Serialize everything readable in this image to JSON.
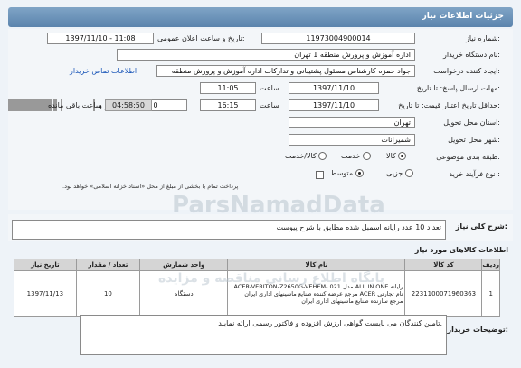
{
  "header": {
    "title": "جزئیات اطلاعات نیاز"
  },
  "form": {
    "need_number": {
      "label": "شماره نیاز:",
      "value": "11973004900014"
    },
    "announce": {
      "label": "تاریخ و ساعت اعلان عمومی:",
      "value": "1397/11/10 - 11:08"
    },
    "buyer_org": {
      "label": "نام دستگاه خریدار:",
      "value": "اداره آموزش و پرورش منطقه 1 تهران"
    },
    "creator": {
      "label": "ایجاد کننده درخواست:",
      "value": "جواد حمزه کارشناس مسئول پشتیبانی و تدارکات اداره آموزش و پرورش منطقه",
      "contact_link": "اطلاعات تماس خریدار"
    },
    "reply_deadline": {
      "label": "مهلت ارسال پاسخ: تا تاریخ:",
      "date": "1397/11/10",
      "time_label": "ساعت",
      "time": "11:05"
    },
    "validity": {
      "label": "حداقل تاریخ اعتبار قیمت: تا تاریخ:",
      "date": "1397/11/10",
      "time_label": "ساعت",
      "time": "16:15",
      "days": "0",
      "days_label": "روز و",
      "remaining": "04:58:50",
      "remaining_label": "ساعت باقی مانده"
    },
    "province": {
      "label": "استان محل تحویل:",
      "value": "تهران"
    },
    "city": {
      "label": "شهر محل تحویل:",
      "value": "شمیرانات"
    },
    "category": {
      "label": "طبقه بندی موضوعی:",
      "options": [
        "کالا",
        "خدمت",
        "کالا/خدمت"
      ],
      "selected": "کالا"
    },
    "process": {
      "label": "نوع فرآیند خرید :",
      "options": [
        "جزیی",
        "متوسط"
      ],
      "selected": "متوسط",
      "checkbox_note": "پرداخت تمام یا بخشی از مبلغ از محل «اسناد خزانه اسلامی» خواهد بود."
    }
  },
  "need_desc": {
    "label": "شرح کلی نیاز:",
    "value": "تعداد 10 عدد رایانه اسمبل شده مطابق با شرح پیوست"
  },
  "goods": {
    "title": "اطلاعات کالاهای مورد نیاز",
    "headers": [
      "ردیف",
      "کد کالا",
      "نام کالا",
      "واحد شمارش",
      "تعداد / مقدار",
      "تاریخ نیاز"
    ],
    "rows": [
      {
        "row": "1",
        "code": "2231100071960363",
        "name": "رایانه ALL IN ONE مدل ACER-VERITON-Z2650G-VEHEM- 021 نام تجارتی ACER مرجع عرضه کننده صنایع ماشینهای اداری ایران مرجع سازنده صنایع ماشینهای اداری ایران",
        "unit": "دستگاه",
        "qty": "10",
        "date": "1397/11/13"
      }
    ]
  },
  "buyer_notes": {
    "label": "توضیحات خریدار:",
    "value": "تامین کنندگان می بایست گواهی ارزش افزوده و فاکتور رسمی ارائه نمایند."
  },
  "watermark": {
    "line1": "ParsNamadData",
    "line2": "پایگاه اطلاع رسانی مناقصه و مزایده"
  }
}
